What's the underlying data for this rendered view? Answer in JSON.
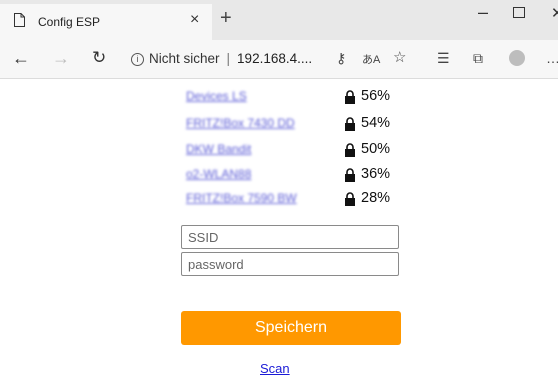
{
  "browser": {
    "tab_title": "Config ESP",
    "tab_close": "×",
    "new_tab": "+",
    "security_label": "Nicht sicher",
    "url": "192.168.4....",
    "separator": "|"
  },
  "networks": [
    {
      "ssid": "Devices LS",
      "signal": "56%",
      "secured": true
    },
    {
      "ssid": "FRITZ!Box 7430 DD",
      "signal": "54%",
      "secured": true
    },
    {
      "ssid": "DKW Bandit",
      "signal": "50%",
      "secured": true
    },
    {
      "ssid": "o2-WLAN88",
      "signal": "36%",
      "secured": true
    },
    {
      "ssid": "FRITZ!Box 7590 BW",
      "signal": "28%",
      "secured": true
    }
  ],
  "form": {
    "ssid_placeholder": "SSID",
    "password_placeholder": "password",
    "ssid_value": "",
    "password_value": "",
    "save_label": "Speichern",
    "scan_label": "Scan"
  },
  "colors": {
    "accent": "#ff9800",
    "link": "#1a1ad6"
  },
  "icons": {
    "back": "arrow-left-icon",
    "forward": "arrow-right-icon",
    "refresh": "refresh-icon",
    "info": "info-icon",
    "key": "key-icon",
    "translate": "translate-icon",
    "star": "star-icon",
    "favorites": "favorites-icon",
    "collections": "collections-icon",
    "profile": "profile-icon",
    "more": "more-icon",
    "lock": "lock-icon"
  }
}
